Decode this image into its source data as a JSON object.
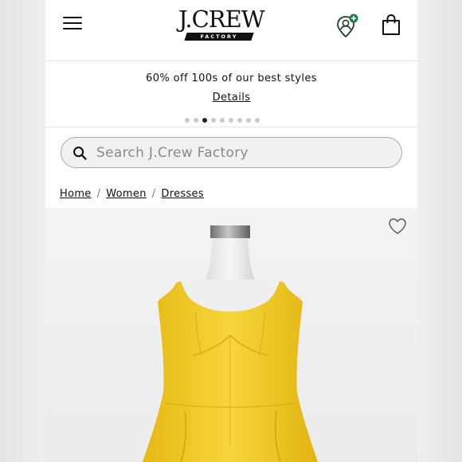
{
  "header": {
    "logo_text": "J.CREW",
    "logo_sub": "FACTORY",
    "menu_icon": "hamburger-menu-icon",
    "account_icon": "account-location-icon",
    "bag_icon": "shopping-bag-icon",
    "brand_accent": "#1f7a4d"
  },
  "promo": {
    "text": "60% off 100s of our best styles",
    "link_label": "Details",
    "carousel_count": 9,
    "carousel_active_index": 2
  },
  "search": {
    "placeholder": "Search J.Crew Factory",
    "value": ""
  },
  "breadcrumb": {
    "items": [
      "Home",
      "Women",
      "Dresses"
    ],
    "separator": "/"
  },
  "product": {
    "wishlist_icon": "heart-outline-icon",
    "image_subject": "yellow-sleeveless-dress-on-mannequin",
    "dress_color": "#f2cf2e"
  }
}
